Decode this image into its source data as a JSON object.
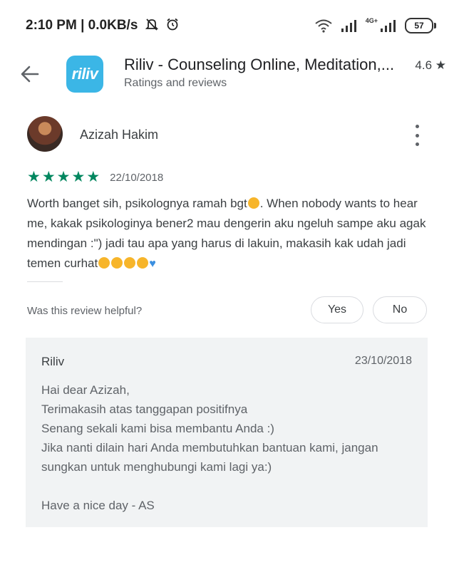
{
  "status_bar": {
    "time": "2:10 PM | 0.0KB/s",
    "network_label": "4G+",
    "battery": "57"
  },
  "app_header": {
    "logo_text": "riliv",
    "title": "Riliv - Counseling Online, Meditation,...",
    "subtitle": "Ratings and reviews",
    "rating": "4.6 ★"
  },
  "review": {
    "author": "Azizah Hakim",
    "stars": 5,
    "date": "22/10/2018",
    "text_part1": "Worth banget sih, psikolognya ramah bgt",
    "text_part2": ". When nobody wants to hear me, kakak psikologinya bener2 mau dengerin aku ngeluh sampe aku agak mendingan :\") jadi tau apa yang harus di lakuin, makasih kak udah jadi temen curhat",
    "helpful_question": "Was this review helpful?",
    "yes_label": "Yes",
    "no_label": "No"
  },
  "developer_reply": {
    "author": "Riliv",
    "date": "23/10/2018",
    "text": "Hai dear Azizah,\nTerimakasih atas tanggapan positifnya\nSenang sekali kami bisa membantu Anda :)\nJika nanti dilain hari Anda membutuhkan bantuan kami, jangan sungkan untuk menghubungi kami lagi ya:)\n\nHave a nice day - AS"
  },
  "colors": {
    "star_green": "#01875f",
    "logo_blue": "#3bb6e6",
    "reply_background": "#f1f3f4"
  }
}
